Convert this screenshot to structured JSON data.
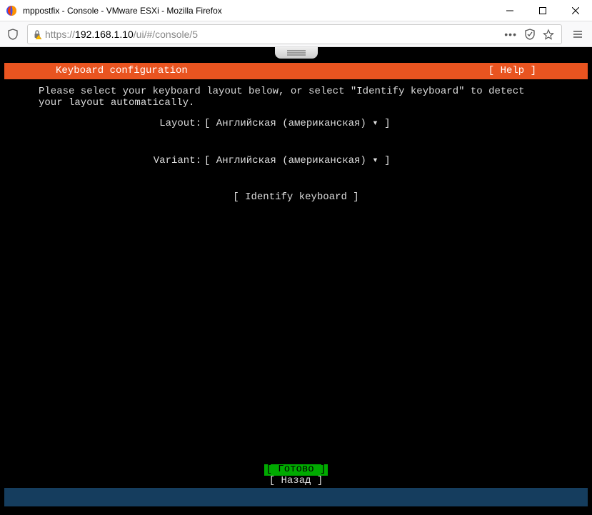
{
  "window": {
    "title": "mppostfix - Console - VMware ESXi - Mozilla Firefox"
  },
  "url": {
    "protocol": "https://",
    "host": "192.168.1.10",
    "path": "/ui/#/console/5"
  },
  "header": {
    "title": "Keyboard configuration",
    "help": "[ Help ]"
  },
  "instructions": "Please select your keyboard layout below, or select \"Identify keyboard\" to detect your layout automatically.",
  "fields": {
    "layout": {
      "label": "Layout:",
      "value": "[ Английская (американская)          ▾ ]"
    },
    "variant": {
      "label": "Variant:",
      "value": "[ Английская (американская)          ▾ ]"
    }
  },
  "identify": "[ Identify keyboard ]",
  "footer": {
    "done": "[ Готово      ]",
    "back": "[ Назад       ]"
  }
}
